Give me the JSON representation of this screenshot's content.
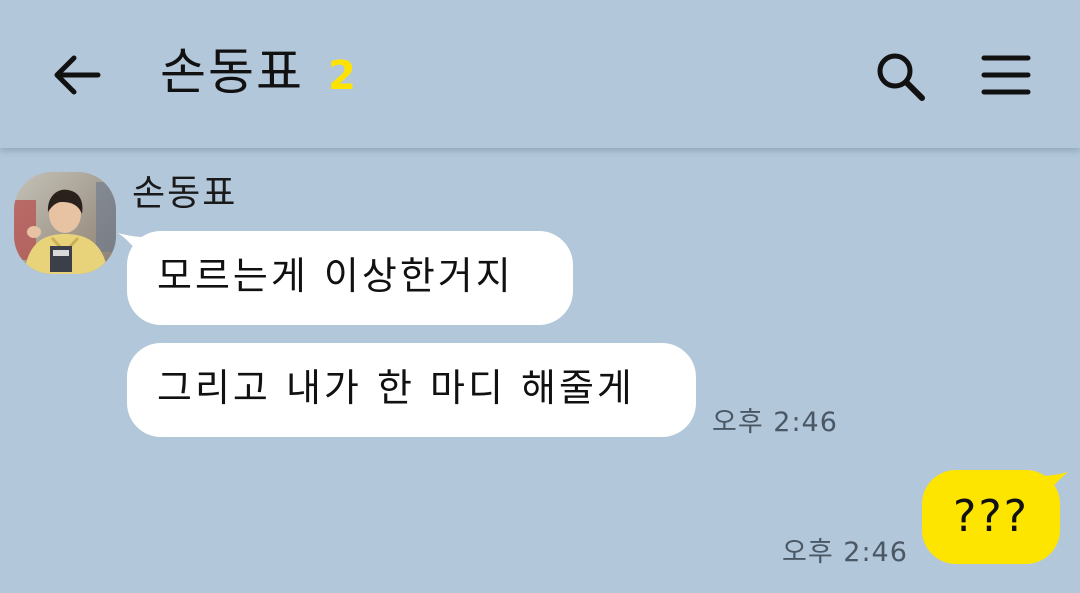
{
  "header": {
    "title": "손동표",
    "member_count": "2",
    "icons": {
      "back": "arrow-left-icon",
      "search": "search-icon",
      "menu": "hamburger-menu-icon"
    }
  },
  "messages": [
    {
      "sender": "손동표",
      "text": "모르는게 이상한거지",
      "direction": "incoming"
    },
    {
      "text": "그리고 내가 한 마디 해줄게",
      "time": "오후 2:46",
      "direction": "incoming"
    },
    {
      "text": "???",
      "time": "오후 2:46",
      "direction": "outgoing"
    }
  ],
  "colors": {
    "background": "#b2c7da",
    "incoming_bubble": "#ffffff",
    "outgoing_bubble": "#fee500",
    "member_count": "#ffe300"
  }
}
